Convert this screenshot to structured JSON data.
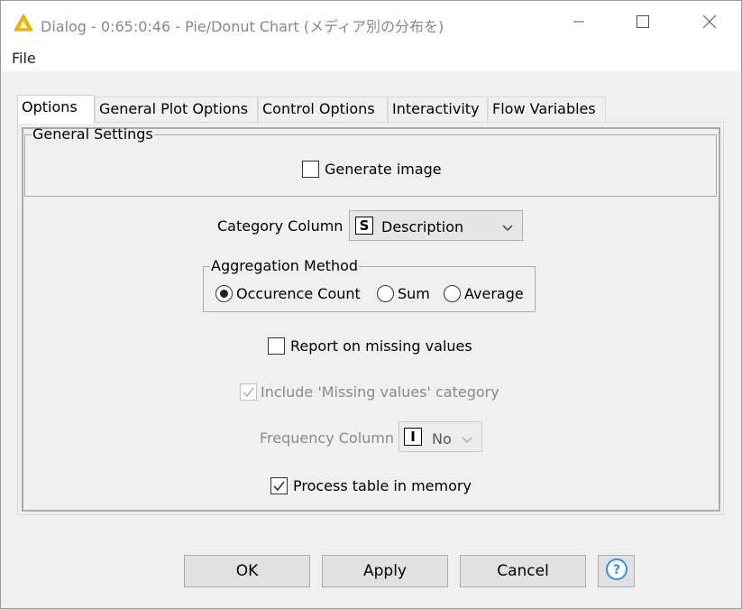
{
  "window": {
    "title": "Dialog - 0:65:0:46 - Pie/Donut Chart (メディア別の分布を)",
    "icon": "warning-triangle-icon",
    "minimize_icon": "minimize-icon",
    "maximize_icon": "maximize-icon",
    "close_icon": "close-icon"
  },
  "menu": {
    "file": "File"
  },
  "tabs": [
    {
      "label": "Options",
      "active": true
    },
    {
      "label": "General Plot Options"
    },
    {
      "label": "Control Options"
    },
    {
      "label": "Interactivity"
    },
    {
      "label": "Flow Variables"
    }
  ],
  "general_settings": {
    "legend": "General Settings",
    "generate_image": {
      "label": "Generate image",
      "checked": false
    }
  },
  "category_column": {
    "label": "Category Column",
    "type_badge": "S",
    "value": "Description"
  },
  "aggregation": {
    "legend": "Aggregation Method",
    "options": [
      {
        "label": "Occurence Count",
        "checked": true
      },
      {
        "label": "Sum",
        "checked": false
      },
      {
        "label": "Average",
        "checked": false
      }
    ]
  },
  "report_missing": {
    "label": "Report on missing values",
    "checked": false
  },
  "include_missing": {
    "label": "Include 'Missing values' category",
    "checked": true,
    "enabled": false
  },
  "frequency_column": {
    "label": "Frequency Column",
    "type_badge": "I",
    "value": "No",
    "enabled": false
  },
  "process_memory": {
    "label": "Process table in memory",
    "checked": true
  },
  "buttons": {
    "ok": "OK",
    "apply": "Apply",
    "cancel": "Cancel",
    "help_icon": "help-icon"
  },
  "colors": {
    "title_icon": "#f5b800",
    "help_icon": "#2f8fe0",
    "check": "#333333"
  }
}
